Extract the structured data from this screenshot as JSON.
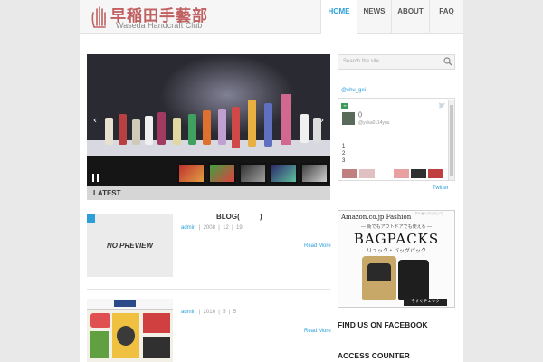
{
  "header": {
    "logo_title": "早稲田手藝部",
    "logo_subtitle": "Waseda Handcraft Club",
    "nav": [
      {
        "label": "HOME",
        "active": true
      },
      {
        "label": "NEWS",
        "active": false
      },
      {
        "label": "ABOUT",
        "active": false
      },
      {
        "label": "FAQ",
        "active": false
      }
    ]
  },
  "slider": {
    "prev_icon": "chevron-left-icon",
    "next_icon": "chevron-right-icon",
    "pause_icon": "pause-icon",
    "thumbnail_count": 5
  },
  "latest": {
    "label": "LATEST"
  },
  "posts": [
    {
      "title": "BLOG(          )",
      "thumbnail_text": "NO PREVIEW",
      "author": "admin",
      "date": "2008  |  12  |  19",
      "read_more": "Read More"
    },
    {
      "author": "admin",
      "date": "2016  |  5  |  5",
      "read_more": "Read More"
    }
  ],
  "sidebar": {
    "search_placeholder": "Search the site",
    "twitter_handle": "@shu_gei",
    "tweet": {
      "name": "()",
      "handle": "@yuka0114yuu",
      "lines": [
        "1",
        "2",
        "3"
      ]
    },
    "twitter_link": "Twitter",
    "ad": {
      "brand": "Amazon.co.jp Fashion",
      "tag": "アドセンスについて",
      "copy": "― 街でもアウトドアでも使える ―",
      "headline": "BAGPACKS",
      "subhead": "リュック・バッグパック",
      "button": "今すぐチェック"
    },
    "facebook_heading": "FIND US ON FACEBOOK",
    "counter_heading": "ACCESS COUNTER"
  },
  "colors": {
    "accent": "#2a9fd8",
    "logo": "#c06060",
    "page_bg": "#e9e9e9"
  }
}
